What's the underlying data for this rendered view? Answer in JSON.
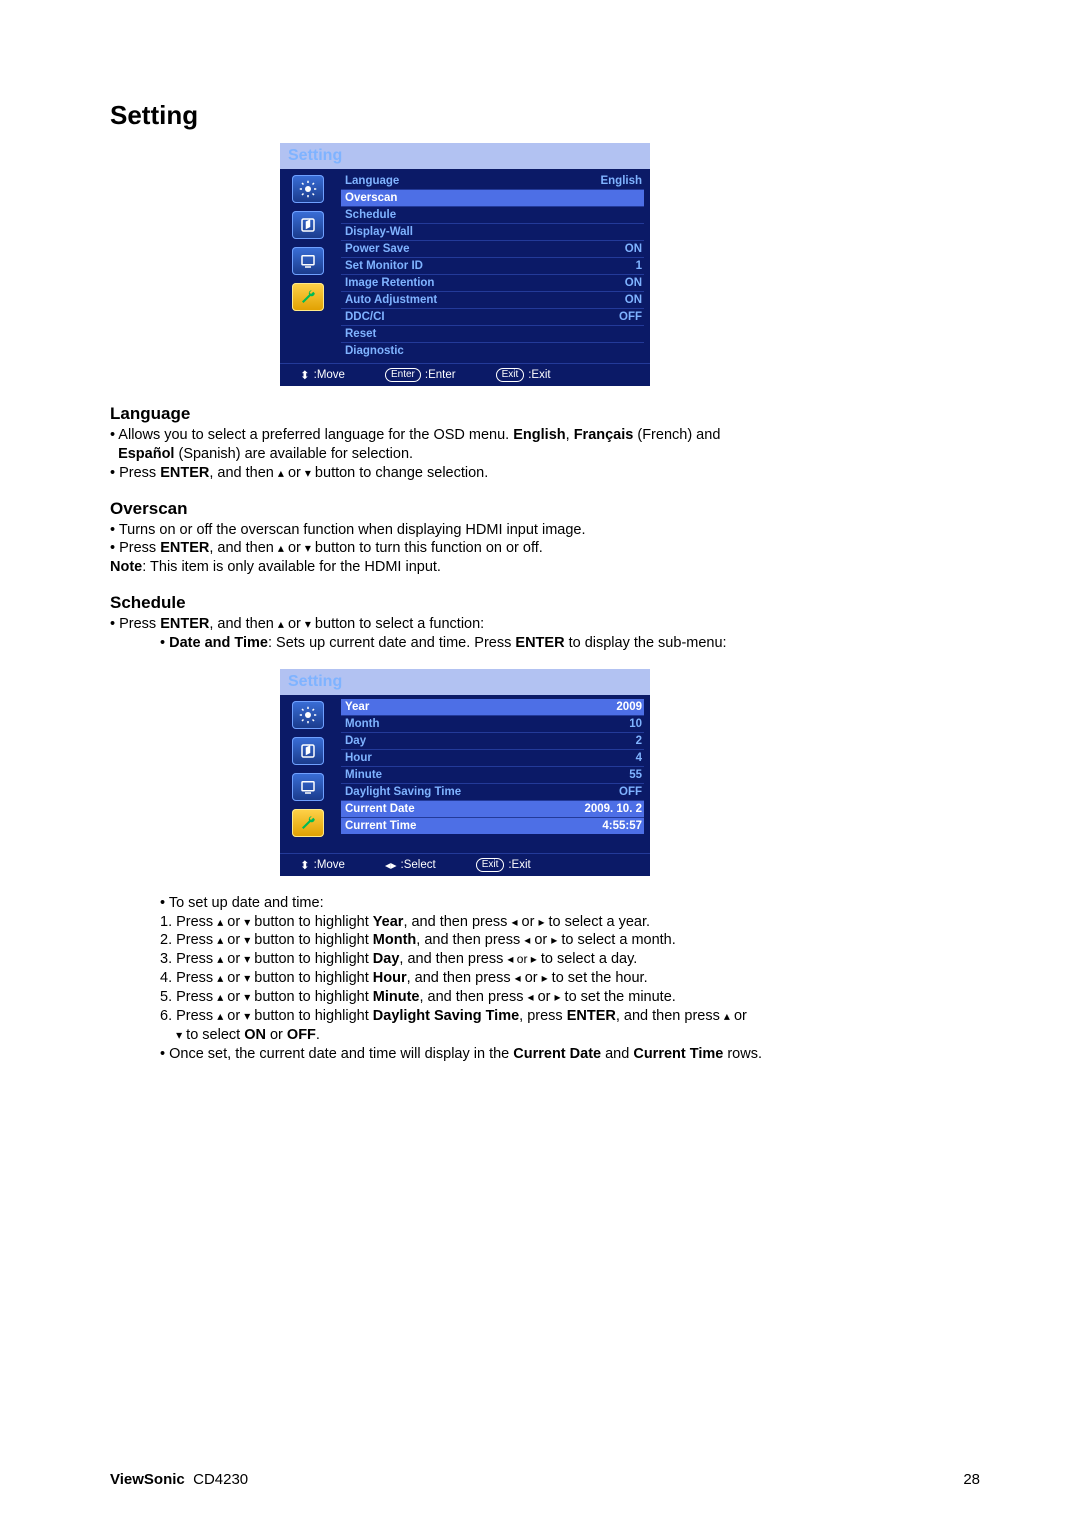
{
  "page": {
    "title": "Setting",
    "footer_brand_bold": "ViewSonic",
    "footer_model": "CD4230",
    "footer_page": "28"
  },
  "osd1": {
    "title": "Setting",
    "rows": [
      {
        "label": "Language",
        "value": "English"
      },
      {
        "label": "Overscan",
        "value": ""
      },
      {
        "label": "Schedule",
        "value": ""
      },
      {
        "label": "Display-Wall",
        "value": ""
      },
      {
        "label": "Power Save",
        "value": "ON"
      },
      {
        "label": "Set Monitor ID",
        "value": "1"
      },
      {
        "label": "Image Retention",
        "value": "ON"
      },
      {
        "label": "Auto Adjustment",
        "value": "ON"
      },
      {
        "label": "DDC/CI",
        "value": "OFF"
      },
      {
        "label": "Reset",
        "value": ""
      },
      {
        "label": "Diagnostic",
        "value": ""
      }
    ],
    "footer": {
      "move": ":Move",
      "enter_pill": "Enter",
      "enter": ":Enter",
      "exit_pill": "Exit",
      "exit": ":Exit"
    }
  },
  "osd2": {
    "title": "Setting",
    "rows": [
      {
        "label": "Year",
        "value": "2009"
      },
      {
        "label": "Month",
        "value": "10"
      },
      {
        "label": "Day",
        "value": "2"
      },
      {
        "label": "Hour",
        "value": "4"
      },
      {
        "label": "Minute",
        "value": "55"
      },
      {
        "label": "Daylight Saving Time",
        "value": "OFF"
      },
      {
        "label": "Current Date",
        "value": "2009. 10. 2"
      },
      {
        "label": "Current Time",
        "value": "4:55:57"
      }
    ],
    "footer": {
      "move": ":Move",
      "select": ":Select",
      "exit_pill": "Exit",
      "exit": ":Exit"
    }
  },
  "sections": {
    "language": {
      "heading": "Language",
      "b1a": "• Allows you to select a preferred language for the OSD menu. ",
      "b1b_bold": "English",
      "b1c": ", ",
      "b1d_bold": "Français",
      "b1e": " (French) and ",
      "b1f_bold": "Español",
      "b1g": " (Spanish) are available for selection.",
      "b2a": "• Press ",
      "b2b_bold": "ENTER",
      "b2c": ", and then ",
      "b2d": " or ",
      "b2e": " button to change selection."
    },
    "overscan": {
      "heading": "Overscan",
      "b1": "• Turns on or off the overscan function when displaying HDMI input image.",
      "b2a": "• Press ",
      "b2b_bold": "ENTER",
      "b2c": ", and then ",
      "b2d": " or ",
      "b2e": " button to turn this function on or off.",
      "note_bold": "Note",
      "note_rest": ": This item is only available for the HDMI input."
    },
    "schedule": {
      "heading": "Schedule",
      "b1a": "• Press ",
      "b1b_bold": "ENTER",
      "b1c": ", and then ",
      "b1d": " or ",
      "b1e": " button to select a function:",
      "sub_dt_a": "• ",
      "sub_dt_bold": "Date and Time",
      "sub_dt_b": ": Sets up current date and time. Press ",
      "sub_dt_c_bold": "ENTER",
      "sub_dt_d": " to display the sub-menu:",
      "steps_intro": "• To set up date and time:",
      "s1a": "1. Press ",
      "s1b": " or ",
      "s1c": " button to highlight ",
      "s1d_bold": "Year",
      "s1e": ", and then press ",
      "s1f": " or ",
      "s1g": " to select a year.",
      "s2a": "2. Press ",
      "s2b": " or ",
      "s2c": " button to highlight ",
      "s2d_bold": "Month",
      "s2e": ", and then press ",
      "s2f": " or ",
      "s2g": " to select a month.",
      "s3a": "3. Press ",
      "s3b": " or ",
      "s3c": " button to highlight ",
      "s3d_bold": "Day",
      "s3e": ", and then press ",
      "s3f": " or ",
      "s3g": " to select a day.",
      "s4a": "4. Press ",
      "s4b": " or ",
      "s4c": " button to highlight ",
      "s4d_bold": "Hour",
      "s4e": ", and then press ",
      "s4f": " or ",
      "s4g": " to set the hour.",
      "s5a": "5. Press ",
      "s5b": " or ",
      "s5c": " button to highlight ",
      "s5d_bold": "Minute",
      "s5e": ", and then press ",
      "s5f": " or ",
      "s5g": " to set the minute.",
      "s6a": "6. Press ",
      "s6b": " or ",
      "s6c": " button to highlight ",
      "s6d_bold": "Daylight Saving Time",
      "s6e": ", press ",
      "s6f_bold": "ENTER",
      "s6g": ", and then press ",
      "s6h": " or ",
      "s6i": " to select ",
      "s6j_bold": "ON",
      "s6k": " or ",
      "s6l_bold": "OFF",
      "s6m": ".",
      "final_a": "• Once set, the current date and time will display in the ",
      "final_b_bold": "Current Date",
      "final_c": " and ",
      "final_d_bold": "Current Time",
      "final_e": " rows."
    }
  },
  "glyphs": {
    "up": "▴",
    "down": "▾",
    "left": "◂",
    "right": "▸",
    "updown": "⬍",
    "leftright": "◂▸"
  }
}
